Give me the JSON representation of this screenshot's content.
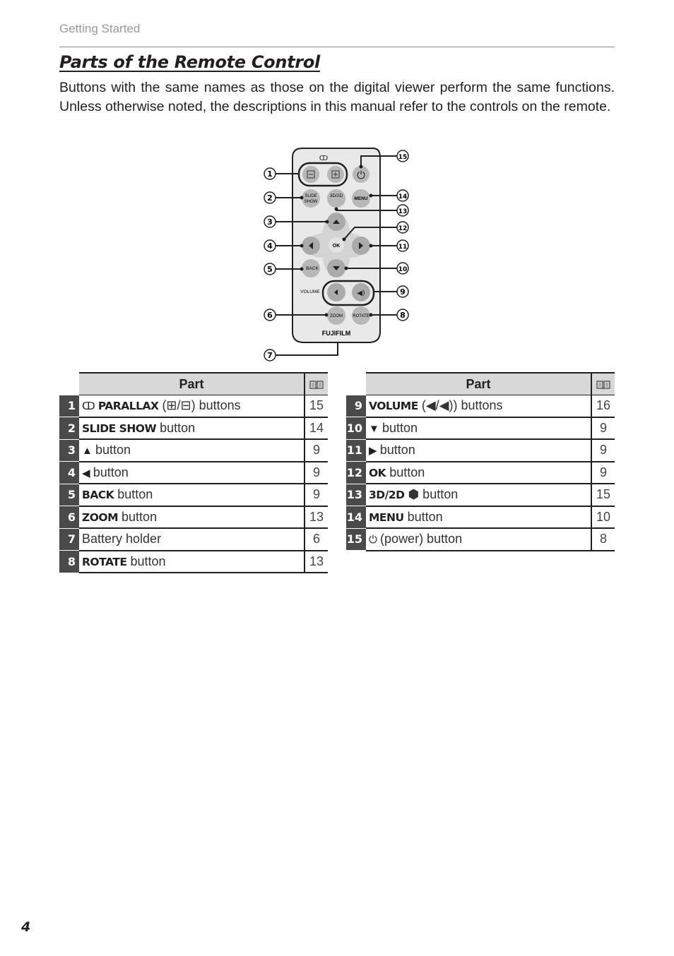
{
  "header": {
    "section": "Getting Started",
    "title": "Parts of the Remote Control"
  },
  "intro_text": "Buttons with the same names as those on the digital viewer perform the same functions. Unless otherwise noted, the descriptions in this manual refer to the controls on the remote.",
  "diagram": {
    "callouts": [
      "1",
      "2",
      "3",
      "4",
      "5",
      "6",
      "7",
      "8",
      "9",
      "10",
      "11",
      "12",
      "13",
      "14",
      "15"
    ],
    "labels": {
      "slide": "SLIDE",
      "show": "SHOW",
      "three_d": "3D/2D",
      "menu": "MENU",
      "ok": "OK",
      "back": "BACK",
      "volume": "VOLUME",
      "zoom": "ZOOM",
      "rotate": "ROTATE",
      "brand": "FUJIFILM"
    }
  },
  "table_headers": {
    "part": "Part",
    "ref_icon": "book-icon"
  },
  "left_table": [
    {
      "num": "1",
      "symbol": "ↀ",
      "bold": "PARALLAX",
      "text": " (⊞/⊟) buttons",
      "ref": "15"
    },
    {
      "num": "2",
      "symbol": "",
      "bold": "SLIDE SHOW",
      "text": " button",
      "ref": "14"
    },
    {
      "num": "3",
      "symbol": "▲",
      "bold": "",
      "text": " button",
      "ref": "9"
    },
    {
      "num": "4",
      "symbol": "◀",
      "bold": "",
      "text": " button",
      "ref": "9"
    },
    {
      "num": "5",
      "symbol": "",
      "bold": "BACK",
      "text": " button",
      "ref": "9"
    },
    {
      "num": "6",
      "symbol": "",
      "bold": "ZOOM",
      "text": " button",
      "ref": "13"
    },
    {
      "num": "7",
      "symbol": "",
      "bold": "",
      "text": "Battery holder",
      "ref": "6"
    },
    {
      "num": "8",
      "symbol": "",
      "bold": "ROTATE",
      "text": " button",
      "ref": "13"
    }
  ],
  "right_table": [
    {
      "num": "9",
      "symbol": "",
      "bold": "VOLUME",
      "text": " (◀/◀)) buttons",
      "ref": "16"
    },
    {
      "num": "10",
      "symbol": "▼",
      "bold": "",
      "text": " button",
      "ref": "9"
    },
    {
      "num": "11",
      "symbol": "▶",
      "bold": "",
      "text": " button",
      "ref": "9"
    },
    {
      "num": "12",
      "symbol": "",
      "bold": "OK",
      "text": " button",
      "ref": "9"
    },
    {
      "num": "13",
      "symbol": "",
      "bold": "3D/2D",
      "text": " ⬢ button",
      "ref": "15"
    },
    {
      "num": "14",
      "symbol": "",
      "bold": "MENU",
      "text": " button",
      "ref": "10"
    },
    {
      "num": "15",
      "symbol": "⏻",
      "bold": "",
      "text": " (power) button",
      "ref": "8"
    }
  ],
  "page_number": "4"
}
